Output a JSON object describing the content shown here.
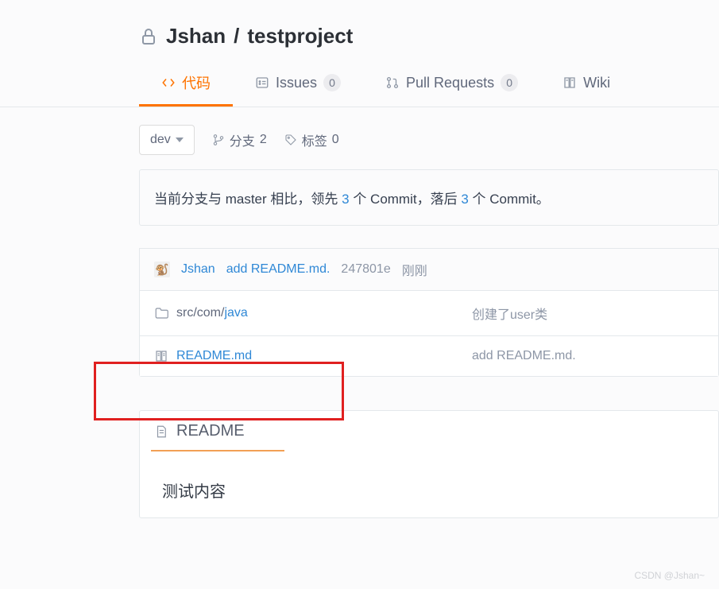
{
  "repo": {
    "owner": "Jshan",
    "name": "testproject"
  },
  "tabs": {
    "code": "代码",
    "issues": "Issues",
    "issues_count": "0",
    "prs": "Pull Requests",
    "prs_count": "0",
    "wiki": "Wiki"
  },
  "branch": {
    "current": "dev",
    "branches_label": "分支",
    "branches_count": "2",
    "tags_label": "标签",
    "tags_count": "0"
  },
  "compare": {
    "prefix": "当前分支与 master 相比，领先 ",
    "ahead": "3",
    "mid": " 个 Commit，落后 ",
    "behind": "3",
    "suffix": " 个 Commit。"
  },
  "last_commit": {
    "user": "Jshan",
    "message": "add README.md.",
    "sha": "247801e",
    "time": "刚刚"
  },
  "files": [
    {
      "name_prefix": "src/com/",
      "name_link": "java",
      "commit_msg": "创建了user类",
      "type": "dir"
    },
    {
      "name_prefix": "",
      "name_link": "README.md",
      "commit_msg": "add README.md.",
      "type": "readme"
    }
  ],
  "readme": {
    "title": "README",
    "body": "测试内容"
  },
  "watermark": "CSDN @Jshan~"
}
